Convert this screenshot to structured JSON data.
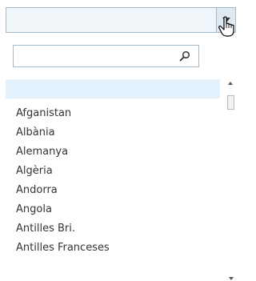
{
  "combo": {
    "value": "",
    "button_icon": "chevron-down-icon",
    "cursor_icon": "hand-pointer-icon"
  },
  "search": {
    "value": "",
    "icon": "search-icon"
  },
  "list": {
    "selected_item": "",
    "items": [
      "Afganistan",
      "Albània",
      "Alemanya",
      "Algèria",
      "Andorra",
      "Angola",
      "Antilles Bri.",
      "Antilles Franceses"
    ]
  },
  "colors": {
    "field_background": "#f0f6fa",
    "border": "#a5b9c8",
    "selection": "#e3f1fc",
    "text": "#333333"
  }
}
